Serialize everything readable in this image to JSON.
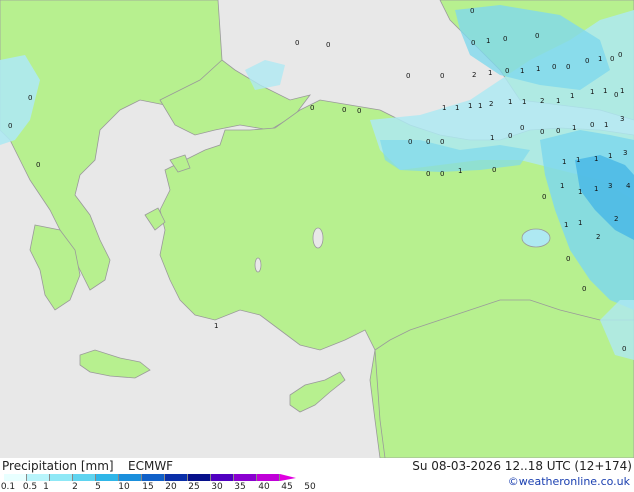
{
  "title": "Precipitation [mm]",
  "model": "ECMWF",
  "datetime": "Su 08-03-2026 12..18 UTC (12+174)",
  "credit": "©weatheronline.co.uk",
  "colors": {
    "sea": "#e8e8e8",
    "land": "#b7f08f",
    "precip_light": "#aee9f2",
    "precip_mid": "#7fd8ec",
    "precip_heavy": "#46b7e6",
    "coast": "#9a9a9a"
  },
  "legend": {
    "ticks": [
      "0.1",
      "0.5",
      "1",
      "2",
      "5",
      "10",
      "15",
      "20",
      "25",
      "30",
      "35",
      "40",
      "45",
      "50"
    ],
    "colors": [
      "#e8ffff",
      "#b8f4fb",
      "#8fe8f6",
      "#5fd4f0",
      "#2fb6e8",
      "#1a8fdc",
      "#1060c8",
      "#0a2fa8",
      "#06108a",
      "#5000c0",
      "#8a00d0",
      "#c000d8",
      "#e000e0"
    ]
  },
  "precip_values": [
    "0",
    "0",
    "0",
    "0",
    "0",
    "0",
    "0",
    "0",
    "1",
    "0",
    "0",
    "0",
    "1",
    "0",
    "0",
    "2",
    "1",
    "0",
    "1",
    "1",
    "0",
    "0",
    "1",
    "2",
    "1",
    "1",
    "1",
    "1",
    "1",
    "2",
    "1",
    "1",
    "1",
    "0",
    "1",
    "1",
    "0",
    "3",
    "0",
    "0",
    "0",
    "0",
    "0",
    "0",
    "1",
    "0",
    "0",
    "0",
    "0",
    "1",
    "0",
    "1",
    "1",
    "1",
    "1",
    "1",
    "0",
    "0",
    "1",
    "3",
    "4",
    "3",
    "1",
    "1",
    "1",
    "2",
    "1",
    "2",
    "0",
    "0",
    "1",
    "0",
    "0",
    "1",
    "0"
  ]
}
